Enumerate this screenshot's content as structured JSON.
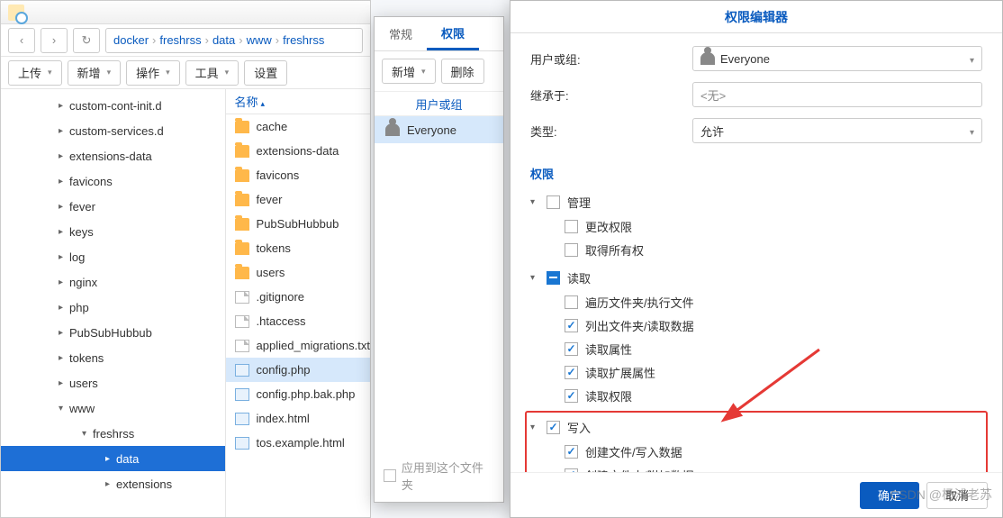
{
  "breadcrumbs": [
    "docker",
    "freshrss",
    "data",
    "www",
    "freshrss"
  ],
  "toolbar": {
    "upload": "上传",
    "new": "新增",
    "action": "操作",
    "tools": "工具",
    "settings": "设置"
  },
  "nameHeader": "名称",
  "tree": [
    {
      "label": "custom-cont-init.d",
      "depth": 1,
      "tw": "▸"
    },
    {
      "label": "custom-services.d",
      "depth": 1,
      "tw": "▸"
    },
    {
      "label": "extensions-data",
      "depth": 1,
      "tw": "▸"
    },
    {
      "label": "favicons",
      "depth": 1,
      "tw": "▸"
    },
    {
      "label": "fever",
      "depth": 1,
      "tw": "▸"
    },
    {
      "label": "keys",
      "depth": 1,
      "tw": "▸"
    },
    {
      "label": "log",
      "depth": 1,
      "tw": "▸"
    },
    {
      "label": "nginx",
      "depth": 1,
      "tw": "▸"
    },
    {
      "label": "php",
      "depth": 1,
      "tw": "▸"
    },
    {
      "label": "PubSubHubbub",
      "depth": 1,
      "tw": "▸"
    },
    {
      "label": "tokens",
      "depth": 1,
      "tw": "▸"
    },
    {
      "label": "users",
      "depth": 1,
      "tw": "▸"
    },
    {
      "label": "www",
      "depth": 1,
      "tw": "▾"
    },
    {
      "label": "freshrss",
      "depth": 2,
      "tw": "▾"
    },
    {
      "label": "data",
      "depth": 3,
      "tw": "▸",
      "sel": true
    },
    {
      "label": "extensions",
      "depth": 3,
      "tw": "▸"
    }
  ],
  "files": [
    {
      "name": "cache",
      "type": "folder"
    },
    {
      "name": "extensions-data",
      "type": "folder"
    },
    {
      "name": "favicons",
      "type": "folder"
    },
    {
      "name": "fever",
      "type": "folder"
    },
    {
      "name": "PubSubHubbub",
      "type": "folder"
    },
    {
      "name": "tokens",
      "type": "folder"
    },
    {
      "name": "users",
      "type": "folder"
    },
    {
      "name": ".gitignore",
      "type": "file"
    },
    {
      "name": ".htaccess",
      "type": "file"
    },
    {
      "name": "applied_migrations.txt",
      "type": "file"
    },
    {
      "name": "config.php",
      "type": "code",
      "sel": true
    },
    {
      "name": "config.php.bak.php",
      "type": "code"
    },
    {
      "name": "index.html",
      "type": "code"
    },
    {
      "name": "tos.example.html",
      "type": "code"
    }
  ],
  "prop": {
    "tabGeneral": "常规",
    "tabPerm": "权限",
    "add": "新增",
    "del": "删除",
    "userGroupCol": "用户或组",
    "everyone": "Everyone",
    "applyAll": "应用到这个文件夹"
  },
  "perm": {
    "title": "权限编辑器",
    "userLabel": "用户或组:",
    "userValue": "Everyone",
    "inheritLabel": "继承于:",
    "inheritValue": "<无>",
    "typeLabel": "类型:",
    "typeValue": "允许",
    "section": "权限",
    "groups": [
      {
        "name": "管理",
        "state": "",
        "items": [
          {
            "label": "更改权限",
            "checked": false
          },
          {
            "label": "取得所有权",
            "checked": false
          }
        ]
      },
      {
        "name": "读取",
        "state": "partial",
        "items": [
          {
            "label": "遍历文件夹/执行文件",
            "checked": false
          },
          {
            "label": "列出文件夹/读取数据",
            "checked": true
          },
          {
            "label": "读取属性",
            "checked": true
          },
          {
            "label": "读取扩展属性",
            "checked": true
          },
          {
            "label": "读取权限",
            "checked": true
          }
        ]
      },
      {
        "name": "写入",
        "state": "checked",
        "highlight": true,
        "items": [
          {
            "label": "创建文件/写入数据",
            "checked": true
          },
          {
            "label": "创建文件夹/附加数据",
            "checked": true
          }
        ]
      }
    ],
    "ok": "确定",
    "cancel": "取消"
  },
  "watermark": "CSDN @杨浦老苏"
}
